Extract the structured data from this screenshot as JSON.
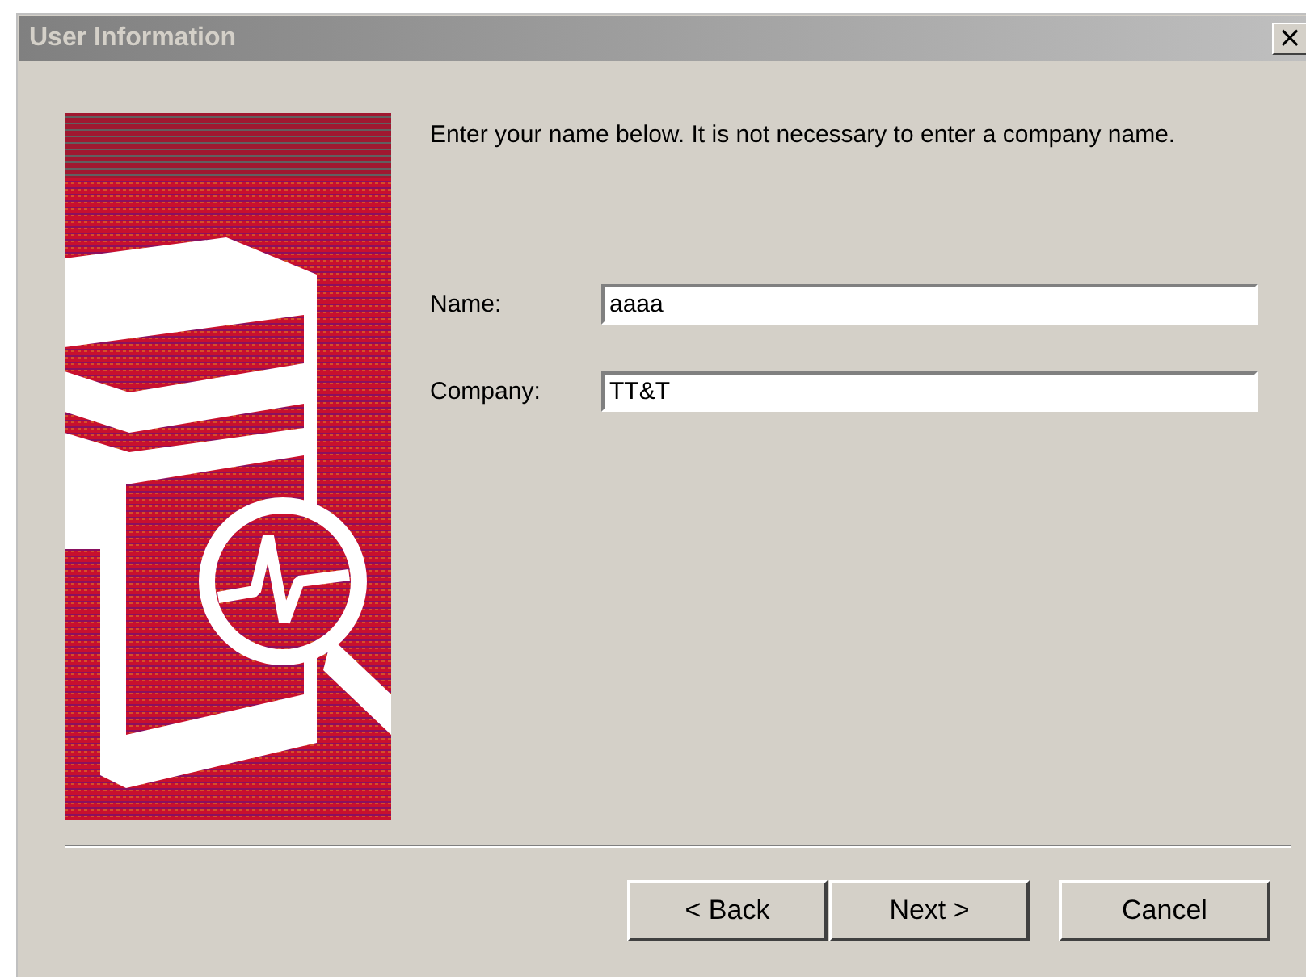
{
  "window": {
    "title": "User Information",
    "close": "×"
  },
  "instructions": "Enter your name below.  It is not necessary to enter a company name.",
  "fields": [
    {
      "label": "Name:",
      "value": "aaaa"
    },
    {
      "label": "Company:",
      "value": "TT&T"
    }
  ],
  "buttons": [
    {
      "kind": "back",
      "label": "< Back"
    },
    {
      "kind": "next",
      "label": "Next >"
    },
    {
      "kind": "cancel",
      "label": "Cancel"
    }
  ]
}
